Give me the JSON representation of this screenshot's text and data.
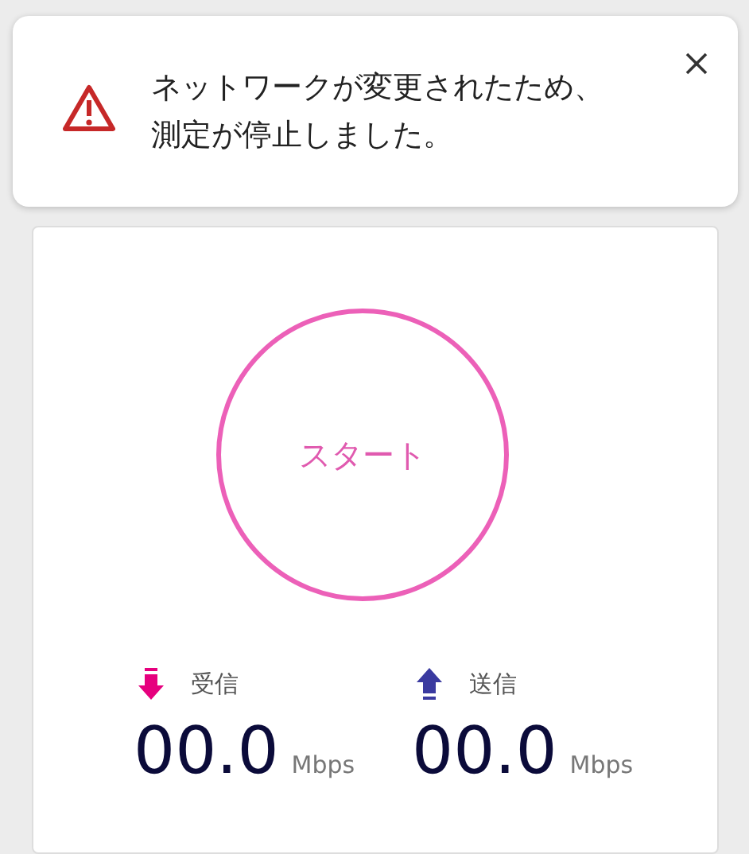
{
  "alert": {
    "kind": "warning",
    "message": "ネットワークが変更されたため、測定が停止しました。"
  },
  "start_button": {
    "label": "スタート"
  },
  "metrics": [
    {
      "kind": "download",
      "label": "受信",
      "value": "00.0",
      "unit": "Mbps"
    },
    {
      "kind": "upload",
      "label": "送信",
      "value": "00.0",
      "unit": "Mbps"
    }
  ]
}
